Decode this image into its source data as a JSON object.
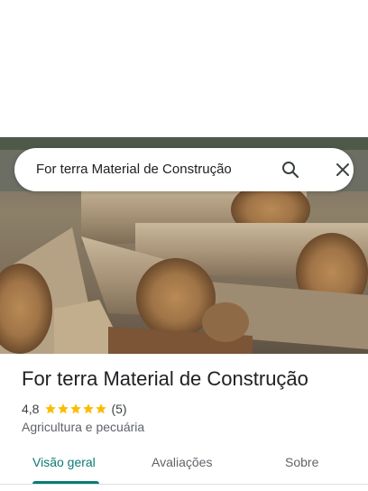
{
  "search": {
    "query": "For terra Material de Construção"
  },
  "place": {
    "name": "For terra Material de Construção",
    "rating": "4,8",
    "stars": 5,
    "review_count": "(5)",
    "category": "Agricultura e pecuária"
  },
  "tabs": [
    {
      "label": "Visão geral",
      "active": true
    },
    {
      "label": "Avaliações",
      "active": false
    },
    {
      "label": "Sobre",
      "active": false
    }
  ],
  "colors": {
    "accent": "#0b7a75",
    "star": "#fbbc04"
  },
  "icons": {
    "search": "search-icon",
    "close": "close-icon",
    "star": "star-icon"
  }
}
